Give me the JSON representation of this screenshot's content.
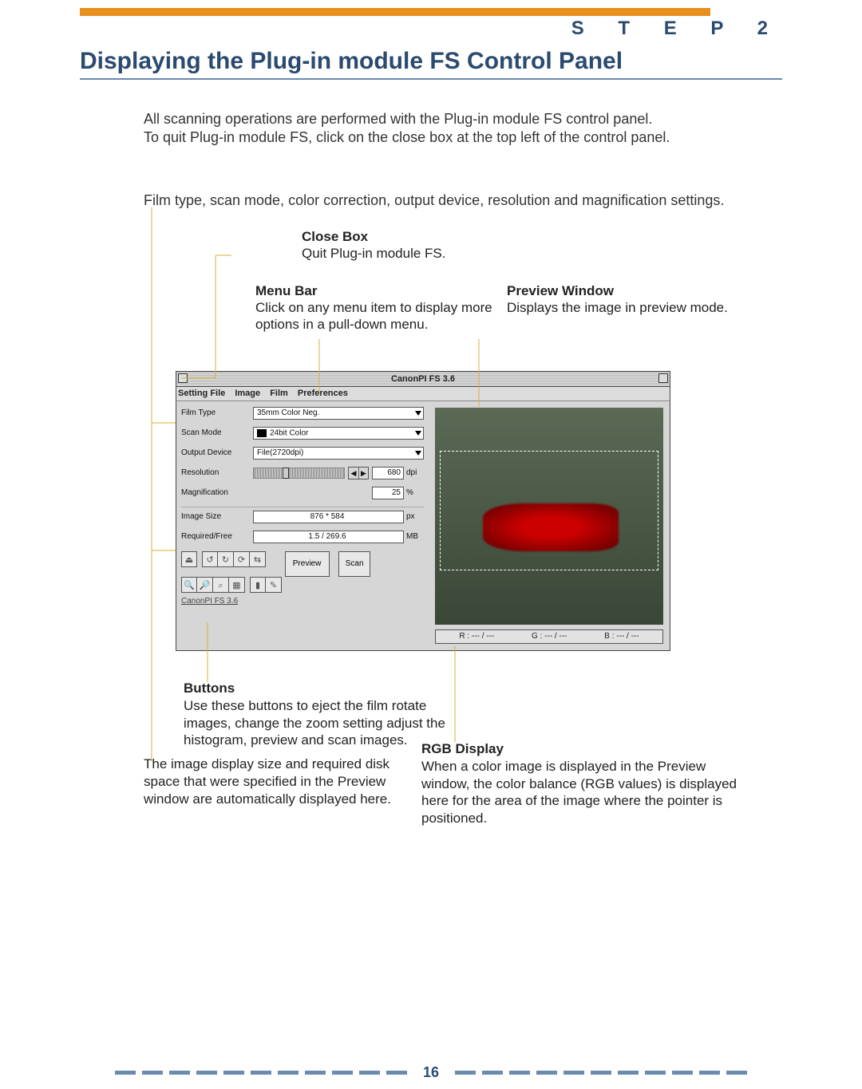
{
  "step_label": "S T E P   2",
  "title": "Displaying the Plug-in module FS Control Panel",
  "intro_line1": "All scanning operations are performed with the Plug-in module FS control panel.",
  "intro_line2": "To quit Plug-in module FS, click on the close box at the top left of the control panel.",
  "sub_caption": "Film type, scan mode, color correction, output device, resolution and magnification settings.",
  "callouts": {
    "close_box": {
      "heading": "Close Box",
      "body": "Quit Plug-in module FS."
    },
    "menu_bar": {
      "heading": "Menu Bar",
      "body": "Click on any menu item to display more options in a pull-down menu."
    },
    "preview_window": {
      "heading": "Preview Window",
      "body": "Displays the image in preview mode."
    }
  },
  "panel": {
    "window_title": "CanonPI FS 3.6",
    "menu_items": [
      "Setting File",
      "Image",
      "Film",
      "Preferences"
    ],
    "settings": {
      "film_type": {
        "label": "Film Type",
        "value": "35mm Color Neg."
      },
      "scan_mode": {
        "label": "Scan Mode",
        "value": "24bit Color"
      },
      "output_device": {
        "label": "Output Device",
        "value": "File(2720dpi)"
      },
      "resolution": {
        "label": "Resolution",
        "value": "680",
        "unit": "dpi"
      },
      "magnification": {
        "label": "Magnification",
        "value": "25",
        "unit": "%"
      },
      "image_size": {
        "label": "Image Size",
        "value": "876 * 584",
        "unit": "px"
      },
      "required_free": {
        "label": "Required/Free",
        "value": "1.5 / 269.6",
        "unit": "MB"
      }
    },
    "buttons": {
      "preview_label": "Preview",
      "scan_label": "Scan"
    },
    "status_text": "CanonPI FS 3.6",
    "rgb_display": {
      "r": "R : --- / ---",
      "g": "G : --- / ---",
      "b": "B : --- / ---"
    }
  },
  "annotations": {
    "buttons": {
      "heading": "Buttons",
      "body": "Use these buttons to eject the film rotate images, change the zoom setting adjust the histogram, preview and scan images."
    },
    "size_info": "The image display size and required disk space that were specified in the Preview window are automatically displayed here.",
    "rgb": {
      "heading": "RGB Display",
      "body": "When a color image is displayed in the Preview window, the color balance (RGB values) is displayed here for the area of the image where the pointer is positioned."
    }
  },
  "page_number": "16"
}
